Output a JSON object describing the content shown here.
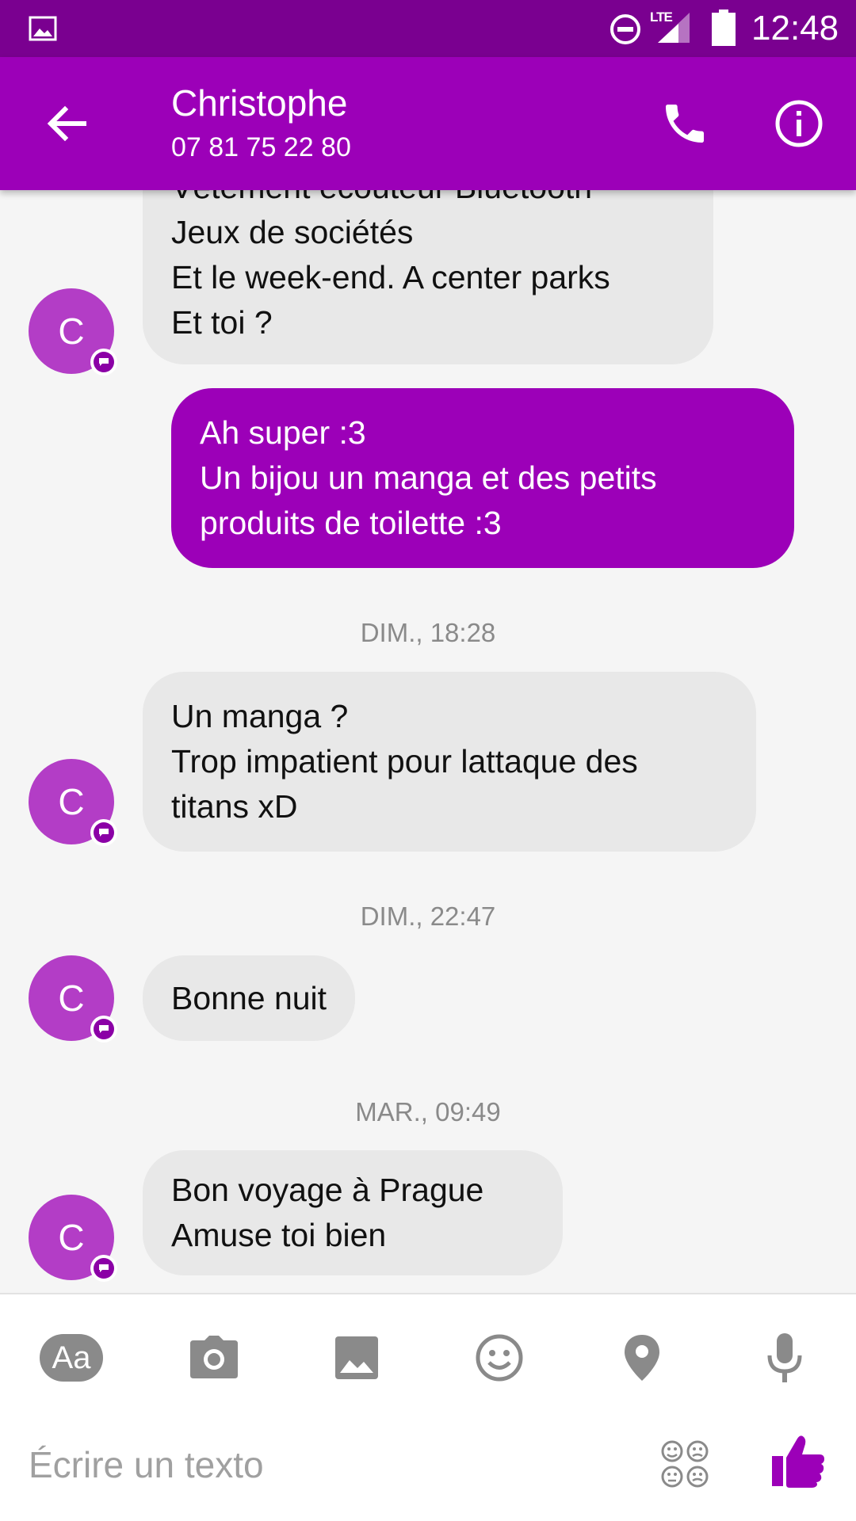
{
  "status_bar": {
    "time": "12:48",
    "network": "LTE",
    "icons": [
      "gallery-icon",
      "do-not-disturb-icon",
      "signal-icon",
      "battery-icon"
    ]
  },
  "header": {
    "contact_name": "Christophe",
    "phone_number": "07 81 75 22 80",
    "avatar_letter": "C"
  },
  "messages": [
    {
      "type": "in",
      "text": "Vêtement écouteur Bluetooth\nJeux de sociétés\nEt le week-end. A center parks\nEt toi ?"
    },
    {
      "type": "out",
      "text": "Ah super :3\nUn bijou un manga et des petits\nproduits de toilette :3"
    },
    {
      "type": "timestamp",
      "text": "DIM., 18:28"
    },
    {
      "type": "in",
      "text": "Un manga ?\nTrop impatient pour lattaque des\ntitans xD"
    },
    {
      "type": "timestamp",
      "text": "DIM., 22:47"
    },
    {
      "type": "in",
      "text": "Bonne nuit"
    },
    {
      "type": "timestamp",
      "text": "MAR., 09:49"
    },
    {
      "type": "in",
      "text": "Bon voyage à Prague\nAmuse toi bien"
    }
  ],
  "composer": {
    "aa_label": "Aa",
    "placeholder": "Écrire un texto",
    "tools": [
      "text-format-icon",
      "camera-icon",
      "image-icon",
      "emoji-icon",
      "location-icon",
      "microphone-icon"
    ]
  },
  "colors": {
    "primary": "#9c00b8",
    "status_bar": "#7a0090",
    "avatar": "#b33dc6",
    "incoming_bubble": "#e8e8e8"
  }
}
